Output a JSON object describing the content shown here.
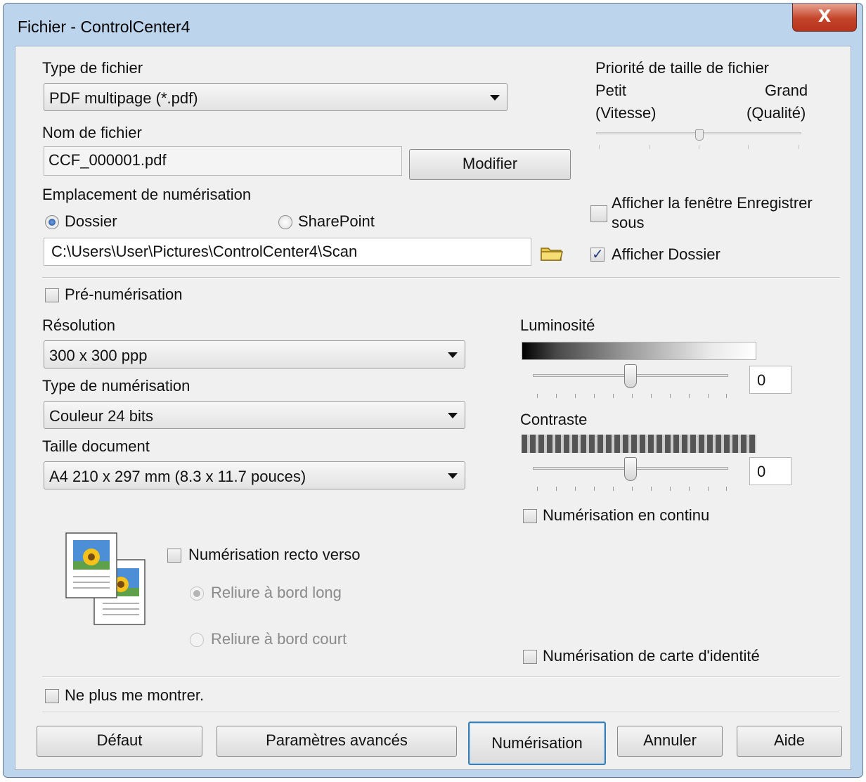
{
  "window": {
    "title": "Fichier - ControlCenter4",
    "close_label": "X"
  },
  "file_type": {
    "label": "Type de fichier",
    "value": "PDF multipage (*.pdf)"
  },
  "file_name": {
    "label": "Nom de fichier",
    "value": "CCF_000001.pdf",
    "change_button": "Modifier"
  },
  "file_size_priority": {
    "label": "Priorité de taille de fichier",
    "small": "Petit",
    "small_sub": "(Vitesse)",
    "large": "Grand",
    "large_sub": "(Qualité)",
    "level_fraction": 0.5
  },
  "scan_location": {
    "label": "Emplacement de numérisation",
    "option_folder": "Dossier",
    "option_sharepoint": "SharePoint",
    "selected": "Dossier",
    "path": "C:\\Users\\User\\Pictures\\ControlCenter4\\Scan"
  },
  "show_save_as": {
    "label_line1": "Afficher la fenêtre Enregistrer",
    "label_line2": "sous",
    "checked": false
  },
  "show_folder": {
    "label": "Afficher Dossier",
    "checked": true
  },
  "prescan": {
    "label": "Pré-numérisation",
    "checked": false
  },
  "resolution": {
    "label": "Résolution",
    "value": "300 x 300 ppp"
  },
  "scan_type": {
    "label": "Type de numérisation",
    "value": "Couleur 24 bits"
  },
  "document_size": {
    "label": "Taille document",
    "value": "A4 210 x 297 mm (8.3 x 11.7 pouces)"
  },
  "brightness": {
    "label": "Luminosité",
    "value": "0"
  },
  "contrast": {
    "label": "Contraste",
    "value": "0"
  },
  "continuous_scan": {
    "label": "Numérisation en continu",
    "checked": false
  },
  "duplex": {
    "label": "Numérisation recto verso",
    "checked": false,
    "long_edge": "Reliure à bord long",
    "short_edge": "Reliure à bord court",
    "selected": "Reliure à bord long"
  },
  "id_card_scan": {
    "label": "Numérisation de carte d'identité",
    "checked": false
  },
  "dont_show": {
    "label": "Ne plus me montrer.",
    "checked": false
  },
  "buttons": {
    "default": "Défaut",
    "advanced": "Paramètres avancés",
    "scan": "Numérisation",
    "cancel": "Annuler",
    "help": "Aide"
  },
  "colors": {
    "titlebar": "#bcd4ec",
    "close": "#c4442a",
    "dialog_bg": "#f0f0f0",
    "default_button_border": "#3c7fb1"
  }
}
